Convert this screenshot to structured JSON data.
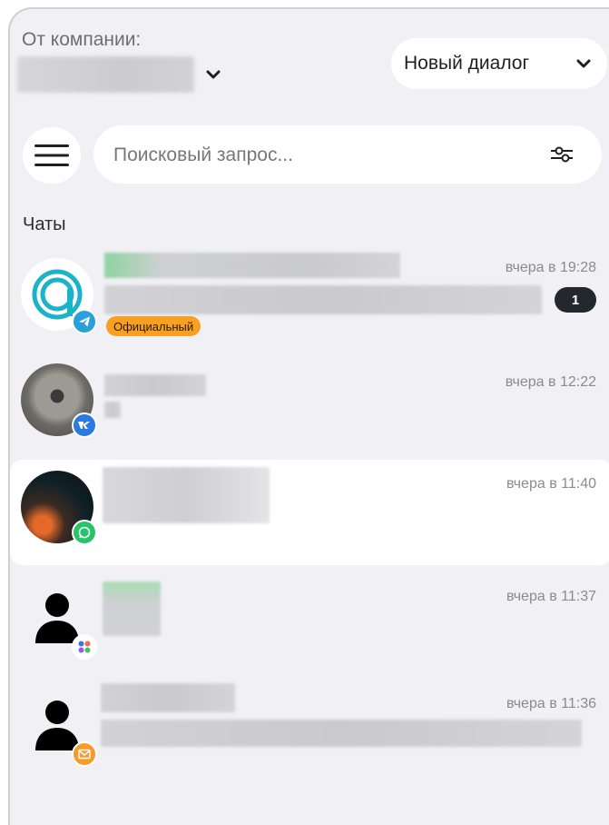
{
  "header": {
    "company_label": "От компании:",
    "new_dialog_label": "Новый диалог"
  },
  "search": {
    "placeholder": "Поисковый запрос..."
  },
  "chats": {
    "title": "Чаты",
    "items": [
      {
        "time": "вчера в 19:28",
        "unread": "1",
        "tag": "Официальный",
        "channel": "telegram-icon",
        "avatar": "logo-a-icon"
      },
      {
        "time": "вчера в 12:22",
        "channel": "vk-icon",
        "avatar": "photo-avatar"
      },
      {
        "time": "вчера в 11:40",
        "channel": "whatsapp-icon",
        "avatar": "photo-avatar",
        "selected": true
      },
      {
        "time": "вчера в 11:37",
        "channel": "dots-icon",
        "avatar": "person-icon"
      },
      {
        "time": "вчера в 11:36",
        "channel": "email-icon",
        "avatar": "person-icon"
      }
    ]
  },
  "colors": {
    "background": "#f1f1f5",
    "card": "#ffffff",
    "official_badge": "#f7a021",
    "unread_badge": "#23272e",
    "telegram": "#2a9fd8",
    "vk": "#2a7ae2",
    "whatsapp": "#25c466",
    "email": "#f79a2a"
  }
}
